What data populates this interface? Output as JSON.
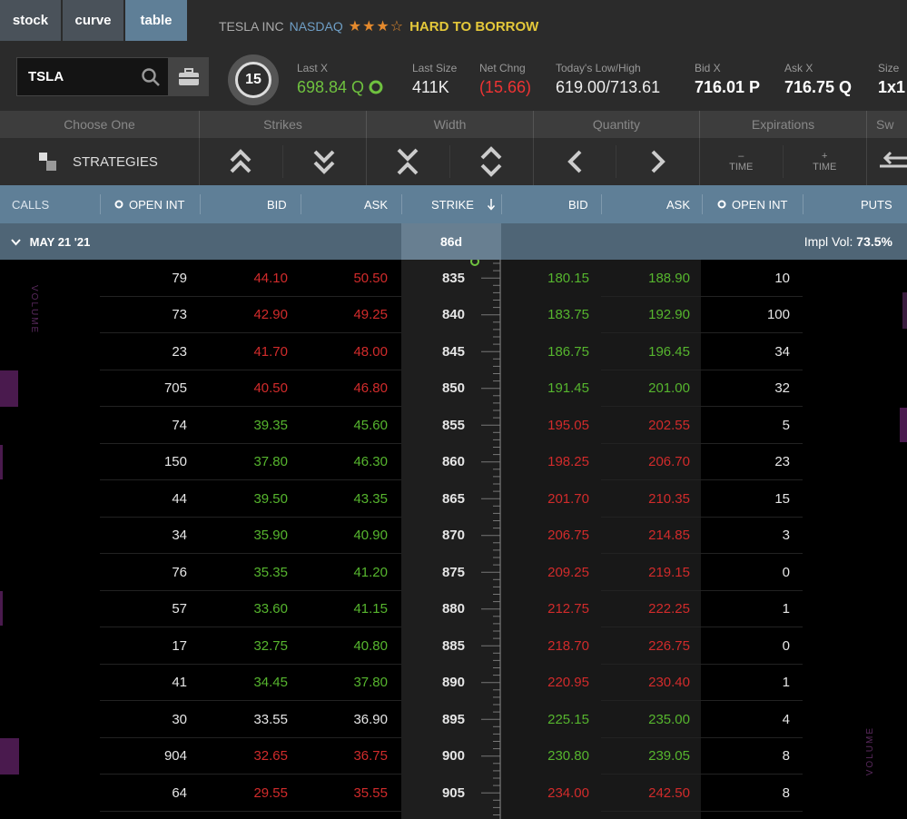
{
  "tabs": [
    {
      "label": "stock"
    },
    {
      "label": "curve"
    },
    {
      "label": "table"
    }
  ],
  "symbol_header": {
    "company": "TESLA INC",
    "exchange": "NASDAQ",
    "stars": "★★★☆",
    "badge": "HARD TO BORROW"
  },
  "search": {
    "value": "TSLA"
  },
  "counter": "15",
  "stats": {
    "last_x": {
      "label": "Last X",
      "value": "698.84 Q"
    },
    "last_size": {
      "label": "Last Size",
      "value": "411K"
    },
    "net_chng": {
      "label": "Net Chng",
      "value": "(15.66)"
    },
    "low_high": {
      "label": "Today's Low/High",
      "value": "619.00/713.61"
    },
    "bid_x": {
      "label": "Bid X",
      "value": "716.01 P"
    },
    "ask_x": {
      "label": "Ask X",
      "value": "716.75 Q"
    },
    "size": {
      "label": "Size",
      "value": "1x1"
    }
  },
  "controls": {
    "headers": [
      "Choose One",
      "Strikes",
      "Width",
      "Quantity",
      "Expirations",
      "Sw"
    ],
    "strategies_label": "STRATEGIES",
    "time_minus": "TIME",
    "time_plus": "TIME",
    "minus_sign": "–",
    "plus_sign": "+"
  },
  "columns": {
    "calls": "CALLS",
    "open_int_left": "OPEN INT",
    "bid_left": "BID",
    "ask_left": "ASK",
    "strike": "STRIKE",
    "bid_right": "BID",
    "ask_right": "ASK",
    "open_int_right": "OPEN INT",
    "puts": "PUTS"
  },
  "expiration": {
    "label": "MAY 21 '21",
    "days": "86d",
    "iv_label": "Impl Vol:",
    "iv_value": "73.5%"
  },
  "volume_label": "VOLUME",
  "rows": [
    {
      "oi_c": "79",
      "bid_c": "44.10",
      "ask_c": "50.50",
      "strike": "835",
      "bid_p": "180.15",
      "ask_p": "188.90",
      "oi_p": "10",
      "call_color": "red",
      "put_color": "green"
    },
    {
      "oi_c": "73",
      "bid_c": "42.90",
      "ask_c": "49.25",
      "strike": "840",
      "bid_p": "183.75",
      "ask_p": "192.90",
      "oi_p": "100",
      "call_color": "red",
      "put_color": "green"
    },
    {
      "oi_c": "23",
      "bid_c": "41.70",
      "ask_c": "48.00",
      "strike": "845",
      "bid_p": "186.75",
      "ask_p": "196.45",
      "oi_p": "34",
      "call_color": "red",
      "put_color": "green"
    },
    {
      "oi_c": "705",
      "bid_c": "40.50",
      "ask_c": "46.80",
      "strike": "850",
      "bid_p": "191.45",
      "ask_p": "201.00",
      "oi_p": "32",
      "call_color": "red",
      "put_color": "green"
    },
    {
      "oi_c": "74",
      "bid_c": "39.35",
      "ask_c": "45.60",
      "strike": "855",
      "bid_p": "195.05",
      "ask_p": "202.55",
      "oi_p": "5",
      "call_color": "green",
      "put_color": "red"
    },
    {
      "oi_c": "150",
      "bid_c": "37.80",
      "ask_c": "46.30",
      "strike": "860",
      "bid_p": "198.25",
      "ask_p": "206.70",
      "oi_p": "23",
      "call_color": "green",
      "put_color": "red"
    },
    {
      "oi_c": "44",
      "bid_c": "39.50",
      "ask_c": "43.35",
      "strike": "865",
      "bid_p": "201.70",
      "ask_p": "210.35",
      "oi_p": "15",
      "call_color": "green",
      "put_color": "red"
    },
    {
      "oi_c": "34",
      "bid_c": "35.90",
      "ask_c": "40.90",
      "strike": "870",
      "bid_p": "206.75",
      "ask_p": "214.85",
      "oi_p": "3",
      "call_color": "green",
      "put_color": "red"
    },
    {
      "oi_c": "76",
      "bid_c": "35.35",
      "ask_c": "41.20",
      "strike": "875",
      "bid_p": "209.25",
      "ask_p": "219.15",
      "oi_p": "0",
      "call_color": "green",
      "put_color": "red"
    },
    {
      "oi_c": "57",
      "bid_c": "33.60",
      "ask_c": "41.15",
      "strike": "880",
      "bid_p": "212.75",
      "ask_p": "222.25",
      "oi_p": "1",
      "call_color": "green",
      "put_color": "red"
    },
    {
      "oi_c": "17",
      "bid_c": "32.75",
      "ask_c": "40.80",
      "strike": "885",
      "bid_p": "218.70",
      "ask_p": "226.75",
      "oi_p": "0",
      "call_color": "green",
      "put_color": "red"
    },
    {
      "oi_c": "41",
      "bid_c": "34.45",
      "ask_c": "37.80",
      "strike": "890",
      "bid_p": "220.95",
      "ask_p": "230.40",
      "oi_p": "1",
      "call_color": "green",
      "put_color": "red"
    },
    {
      "oi_c": "30",
      "bid_c": "33.55",
      "ask_c": "36.90",
      "strike": "895",
      "bid_p": "225.15",
      "ask_p": "235.00",
      "oi_p": "4",
      "call_color": "white",
      "put_color": "green"
    },
    {
      "oi_c": "904",
      "bid_c": "32.65",
      "ask_c": "36.75",
      "strike": "900",
      "bid_p": "230.80",
      "ask_p": "239.05",
      "oi_p": "8",
      "call_color": "red",
      "put_color": "green"
    },
    {
      "oi_c": "64",
      "bid_c": "29.55",
      "ask_c": "35.55",
      "strike": "905",
      "bid_p": "234.00",
      "ask_p": "242.50",
      "oi_p": "8",
      "call_color": "red",
      "put_color": "red"
    }
  ],
  "colors": {
    "header_blue": "#5f7f97",
    "green": "#56b52e",
    "red": "#d12b2b",
    "badge_yellow": "#e4c83a"
  }
}
